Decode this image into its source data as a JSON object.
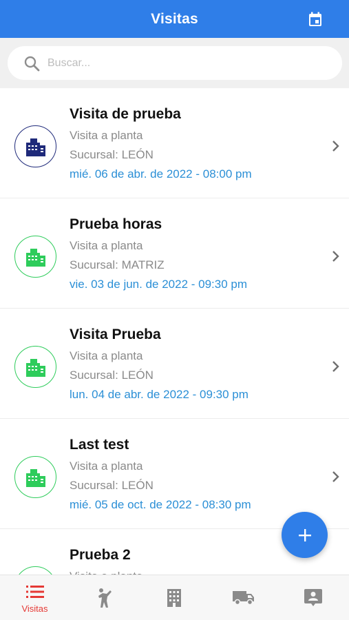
{
  "header": {
    "title": "Visitas",
    "calendar_icon": "calendar-icon"
  },
  "search": {
    "placeholder": "Buscar...",
    "value": "",
    "icon": "search-icon"
  },
  "visits": [
    {
      "title": "Visita de prueba",
      "type": "Visita a planta",
      "branch": "Sucursal: LEÓN",
      "date": "mié. 06 de abr. de 2022 - 08:00 pm",
      "status_color": "#1f2a7a"
    },
    {
      "title": "Prueba horas",
      "type": "Visita a planta",
      "branch": "Sucursal: MATRIZ",
      "date": "vie. 03 de jun. de 2022 - 09:30 pm",
      "status_color": "#2ecc5b"
    },
    {
      "title": "Visita Prueba",
      "type": "Visita a planta",
      "branch": "Sucursal: LEÓN",
      "date": "lun. 04 de abr. de 2022 - 09:30 pm",
      "status_color": "#2ecc5b"
    },
    {
      "title": "Last test",
      "type": "Visita a planta",
      "branch": "Sucursal: LEÓN",
      "date": "mié. 05 de oct. de 2022 - 08:30 pm",
      "status_color": "#2ecc5b"
    },
    {
      "title": "Prueba 2",
      "type": "Visita a planta",
      "branch": "",
      "date": "",
      "status_color": "#2ecc5b"
    }
  ],
  "fab": {
    "icon": "plus-icon"
  },
  "tabbar": {
    "tabs": [
      {
        "label": "Visitas",
        "icon": "list-icon",
        "active": true
      },
      {
        "label": "",
        "icon": "person-walking-icon",
        "active": false
      },
      {
        "label": "",
        "icon": "building-icon",
        "active": false
      },
      {
        "label": "",
        "icon": "truck-icon",
        "active": false
      },
      {
        "label": "",
        "icon": "contact-card-icon",
        "active": false
      }
    ]
  },
  "colors": {
    "primary": "#2f7ee8",
    "date_text": "#2b8fd6",
    "active_tab": "#e53935",
    "inactive_tab": "#8a8a8a"
  }
}
